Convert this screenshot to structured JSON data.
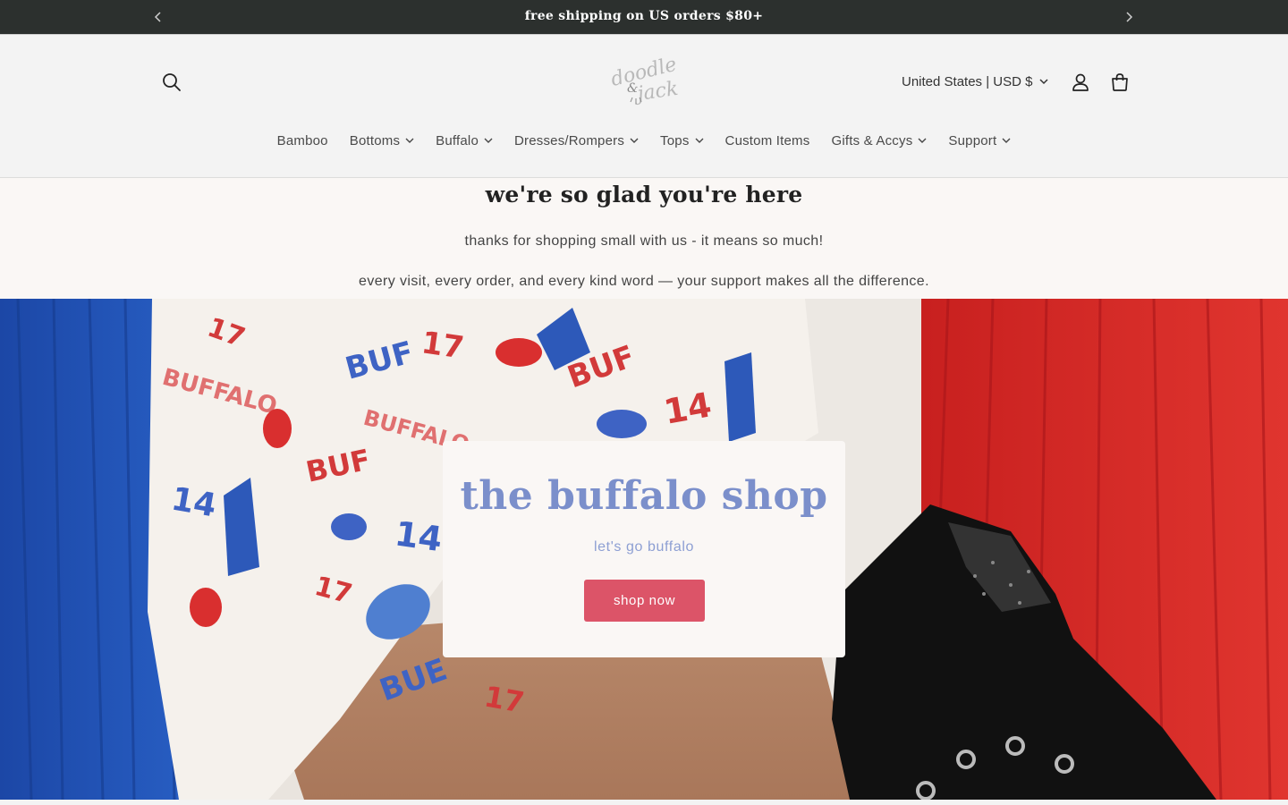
{
  "announcement": {
    "text": "free shipping on US orders $80+",
    "prev_icon": "chevron-left-icon",
    "next_icon": "chevron-right-icon"
  },
  "header": {
    "logo_text_line1": "doodle",
    "logo_text_amp": "&",
    "logo_text_line2": "jack",
    "country_selector": "United States | USD $",
    "icons": [
      "search-icon",
      "account-icon",
      "cart-icon",
      "chevron-down-icon"
    ]
  },
  "nav": {
    "items": [
      {
        "label": "Bamboo",
        "dropdown": false
      },
      {
        "label": "Bottoms",
        "dropdown": true
      },
      {
        "label": "Buffalo",
        "dropdown": true
      },
      {
        "label": "Dresses/Rompers",
        "dropdown": true
      },
      {
        "label": "Tops",
        "dropdown": true
      },
      {
        "label": "Custom Items",
        "dropdown": false
      },
      {
        "label": "Gifts & Accys",
        "dropdown": true
      },
      {
        "label": "Support",
        "dropdown": true
      }
    ]
  },
  "welcome": {
    "heading": "we're so glad you're here",
    "line1": "thanks for shopping small with us - it means so much!",
    "line2": "every visit, every order, and every kind word — your support makes all the difference."
  },
  "hero": {
    "title": "the buffalo shop",
    "subtitle": "let's go buffalo",
    "button": "shop now",
    "colors": {
      "title": "#7b8fcb",
      "button": "#dc5468",
      "blue": "#1f4fb0",
      "red": "#d62a28"
    }
  }
}
